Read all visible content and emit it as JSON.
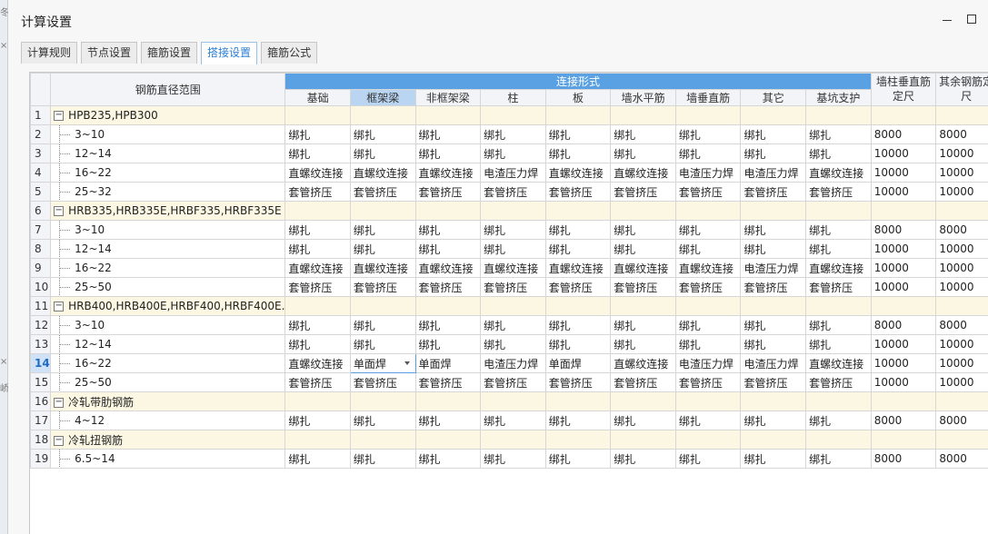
{
  "window": {
    "title": "计算设置"
  },
  "tabs": [
    "计算规则",
    "节点设置",
    "箍筋设置",
    "搭接设置",
    "箍筋公式"
  ],
  "active_tab": "搭接设置",
  "table": {
    "range_header": "钢筋直径范围",
    "group_header": "连接形式",
    "sub_headers": [
      "基础",
      "框架梁",
      "非框架梁",
      "柱",
      "板",
      "墙水平筋",
      "墙垂直筋",
      "其它",
      "基坑支护"
    ],
    "extra_headers": [
      "墙柱垂直筋定尺",
      "其余钢筋定尺"
    ],
    "rows": [
      {
        "no": "1",
        "group": true,
        "label": "HPB235,HPB300",
        "cells": []
      },
      {
        "no": "2",
        "label": "3~10",
        "cells": [
          "绑扎",
          "绑扎",
          "绑扎",
          "绑扎",
          "绑扎",
          "绑扎",
          "绑扎",
          "绑扎",
          "绑扎",
          "8000",
          "8000"
        ]
      },
      {
        "no": "3",
        "label": "12~14",
        "cells": [
          "绑扎",
          "绑扎",
          "绑扎",
          "绑扎",
          "绑扎",
          "绑扎",
          "绑扎",
          "绑扎",
          "绑扎",
          "10000",
          "10000"
        ]
      },
      {
        "no": "4",
        "label": "16~22",
        "cells": [
          "直螺纹连接",
          "直螺纹连接",
          "直螺纹连接",
          "电渣压力焊",
          "直螺纹连接",
          "直螺纹连接",
          "电渣压力焊",
          "电渣压力焊",
          "直螺纹连接",
          "10000",
          "10000"
        ]
      },
      {
        "no": "5",
        "label": "25~32",
        "cells": [
          "套管挤压",
          "套管挤压",
          "套管挤压",
          "套管挤压",
          "套管挤压",
          "套管挤压",
          "套管挤压",
          "套管挤压",
          "套管挤压",
          "10000",
          "10000"
        ]
      },
      {
        "no": "6",
        "group": true,
        "label": "HRB335,HRB335E,HRBF335,HRBF335E",
        "cells": []
      },
      {
        "no": "7",
        "label": "3~10",
        "cells": [
          "绑扎",
          "绑扎",
          "绑扎",
          "绑扎",
          "绑扎",
          "绑扎",
          "绑扎",
          "绑扎",
          "绑扎",
          "8000",
          "8000"
        ]
      },
      {
        "no": "8",
        "label": "12~14",
        "cells": [
          "绑扎",
          "绑扎",
          "绑扎",
          "绑扎",
          "绑扎",
          "绑扎",
          "绑扎",
          "绑扎",
          "绑扎",
          "10000",
          "10000"
        ]
      },
      {
        "no": "9",
        "label": "16~22",
        "cells": [
          "直螺纹连接",
          "直螺纹连接",
          "直螺纹连接",
          "直螺纹连接",
          "直螺纹连接",
          "直螺纹连接",
          "直螺纹连接",
          "电渣压力焊",
          "直螺纹连接",
          "10000",
          "10000"
        ]
      },
      {
        "no": "10",
        "label": "25~50",
        "cells": [
          "套管挤压",
          "套管挤压",
          "套管挤压",
          "套管挤压",
          "套管挤压",
          "套管挤压",
          "套管挤压",
          "套管挤压",
          "套管挤压",
          "10000",
          "10000"
        ]
      },
      {
        "no": "11",
        "group": true,
        "label": "HRB400,HRB400E,HRBF400,HRBF400E...",
        "cells": []
      },
      {
        "no": "12",
        "label": "3~10",
        "cells": [
          "绑扎",
          "绑扎",
          "绑扎",
          "绑扎",
          "绑扎",
          "绑扎",
          "绑扎",
          "绑扎",
          "绑扎",
          "8000",
          "8000"
        ]
      },
      {
        "no": "13",
        "label": "12~14",
        "cells": [
          "绑扎",
          "绑扎",
          "绑扎",
          "绑扎",
          "绑扎",
          "绑扎",
          "绑扎",
          "绑扎",
          "绑扎",
          "10000",
          "10000"
        ]
      },
      {
        "no": "14",
        "label": "16~22",
        "current": true,
        "cells": [
          "直螺纹连接",
          "单面焊",
          "单面焊",
          "电渣压力焊",
          "单面焊",
          "直螺纹连接",
          "电渣压力焊",
          "电渣压力焊",
          "直螺纹连接",
          "10000",
          "10000"
        ]
      },
      {
        "no": "15",
        "label": "25~50",
        "cells": [
          "套管挤压",
          "套管挤压",
          "套管挤压",
          "套管挤压",
          "套管挤压",
          "套管挤压",
          "套管挤压",
          "套管挤压",
          "套管挤压",
          "10000",
          "10000"
        ]
      },
      {
        "no": "16",
        "group": true,
        "label": "冷轧带肋钢筋",
        "cells": []
      },
      {
        "no": "17",
        "label": "4~12",
        "cells": [
          "绑扎",
          "绑扎",
          "绑扎",
          "绑扎",
          "绑扎",
          "绑扎",
          "绑扎",
          "绑扎",
          "绑扎",
          "8000",
          "8000"
        ]
      },
      {
        "no": "18",
        "group": true,
        "label": "冷轧扭钢筋",
        "cells": []
      },
      {
        "no": "19",
        "label": "6.5~14",
        "cells": [
          "绑扎",
          "绑扎",
          "绑扎",
          "绑扎",
          "绑扎",
          "绑扎",
          "绑扎",
          "绑扎",
          "绑扎",
          "8000",
          "8000"
        ]
      }
    ]
  },
  "colors": {
    "header_accent": "#5aa1e3",
    "group_row": "#fbf7e3",
    "tab_active_text": "#2b7fd6"
  }
}
